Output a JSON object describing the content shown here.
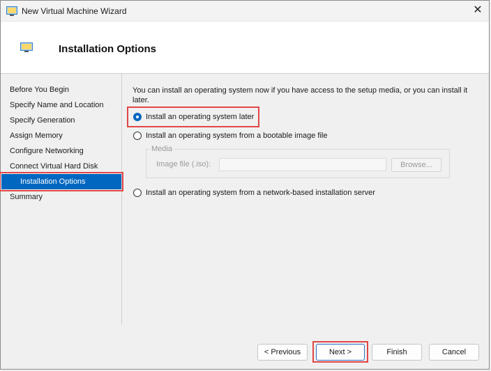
{
  "window": {
    "title": "New Virtual Machine Wizard",
    "close_glyph": "✕"
  },
  "header": {
    "title": "Installation Options"
  },
  "nav": {
    "items": [
      {
        "label": "Before You Begin"
      },
      {
        "label": "Specify Name and Location"
      },
      {
        "label": "Specify Generation"
      },
      {
        "label": "Assign Memory"
      },
      {
        "label": "Configure Networking"
      },
      {
        "label": "Connect Virtual Hard Disk"
      },
      {
        "label": "Installation Options",
        "selected": true
      },
      {
        "label": "Summary"
      }
    ]
  },
  "content": {
    "intro": "You can install an operating system now if you have access to the setup media, or you can install it later.",
    "options": [
      {
        "label": "Install an operating system later",
        "checked": true
      },
      {
        "label": "Install an operating system from a bootable image file",
        "checked": false
      },
      {
        "label": "Install an operating system from a network-based installation server",
        "checked": false
      }
    ],
    "media": {
      "legend": "Media",
      "image_file_label": "Image file (.iso):",
      "image_file_value": "",
      "browse_label": "Browse..."
    }
  },
  "buttons": {
    "previous": "< Previous",
    "next": "Next >",
    "finish": "Finish",
    "cancel": "Cancel"
  },
  "colors": {
    "accent": "#0067c0",
    "highlight": "#e24646"
  }
}
